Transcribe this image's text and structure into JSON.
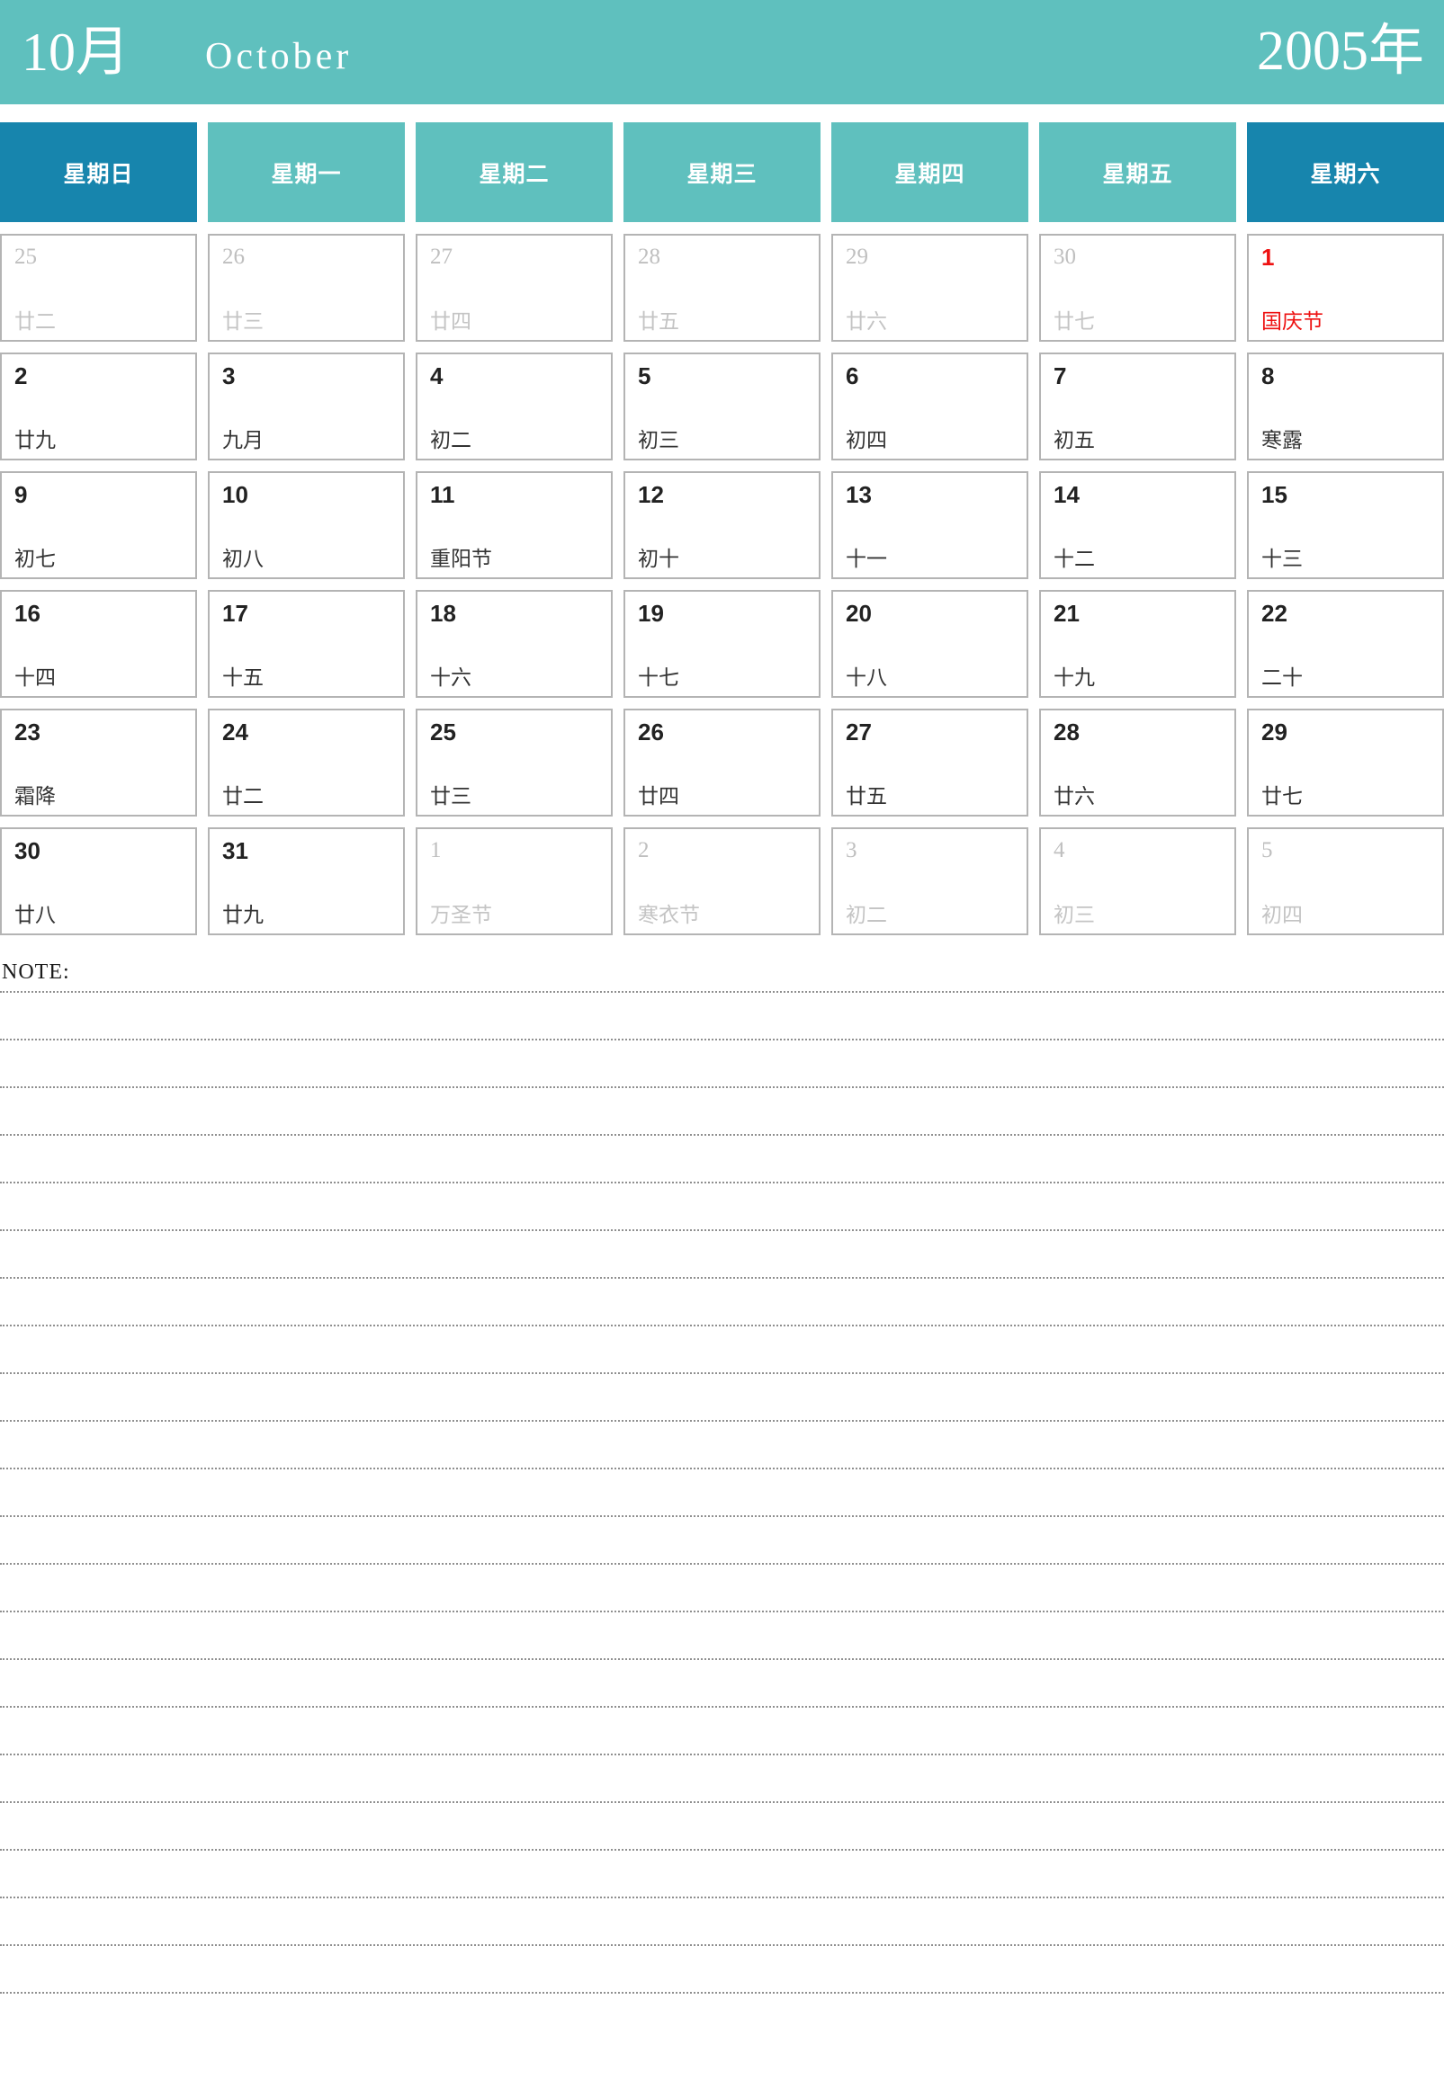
{
  "header": {
    "month_cn": "10月",
    "month_en": "October",
    "year_cn": "2005年",
    "bg_color": "#5FC0BE",
    "text_color": "#ffffff"
  },
  "weekdays": [
    {
      "label": "星期日",
      "type": "weekend",
      "color": "#1785AD"
    },
    {
      "label": "星期一",
      "type": "weekday",
      "color": "#5FC0BE"
    },
    {
      "label": "星期二",
      "type": "weekday",
      "color": "#5FC0BE"
    },
    {
      "label": "星期三",
      "type": "weekday",
      "color": "#5FC0BE"
    },
    {
      "label": "星期四",
      "type": "weekday",
      "color": "#5FC0BE"
    },
    {
      "label": "星期五",
      "type": "weekday",
      "color": "#5FC0BE"
    },
    {
      "label": "星期六",
      "type": "weekend",
      "color": "#1785AD"
    }
  ],
  "accent_colors": {
    "teal": "#5FC0BE",
    "deep_blue": "#1785AD",
    "holiday_red": "#ee1111",
    "muted_gray": "#bfbfbf",
    "cell_border": "#b4b4b4"
  },
  "weeks": [
    [
      {
        "day": "25",
        "lunar": "廿二",
        "state": "muted"
      },
      {
        "day": "26",
        "lunar": "廿三",
        "state": "muted"
      },
      {
        "day": "27",
        "lunar": "廿四",
        "state": "muted"
      },
      {
        "day": "28",
        "lunar": "廿五",
        "state": "muted"
      },
      {
        "day": "29",
        "lunar": "廿六",
        "state": "muted"
      },
      {
        "day": "30",
        "lunar": "廿七",
        "state": "muted"
      },
      {
        "day": "1",
        "lunar": "国庆节",
        "state": "holiday"
      }
    ],
    [
      {
        "day": "2",
        "lunar": "廿九",
        "state": "normal"
      },
      {
        "day": "3",
        "lunar": "九月",
        "state": "normal"
      },
      {
        "day": "4",
        "lunar": "初二",
        "state": "normal"
      },
      {
        "day": "5",
        "lunar": "初三",
        "state": "normal"
      },
      {
        "day": "6",
        "lunar": "初四",
        "state": "normal"
      },
      {
        "day": "7",
        "lunar": "初五",
        "state": "normal"
      },
      {
        "day": "8",
        "lunar": "寒露",
        "state": "normal"
      }
    ],
    [
      {
        "day": "9",
        "lunar": "初七",
        "state": "normal"
      },
      {
        "day": "10",
        "lunar": "初八",
        "state": "normal"
      },
      {
        "day": "11",
        "lunar": "重阳节",
        "state": "normal"
      },
      {
        "day": "12",
        "lunar": "初十",
        "state": "normal"
      },
      {
        "day": "13",
        "lunar": "十一",
        "state": "normal"
      },
      {
        "day": "14",
        "lunar": "十二",
        "state": "normal"
      },
      {
        "day": "15",
        "lunar": "十三",
        "state": "normal"
      }
    ],
    [
      {
        "day": "16",
        "lunar": "十四",
        "state": "normal"
      },
      {
        "day": "17",
        "lunar": "十五",
        "state": "normal"
      },
      {
        "day": "18",
        "lunar": "十六",
        "state": "normal"
      },
      {
        "day": "19",
        "lunar": "十七",
        "state": "normal"
      },
      {
        "day": "20",
        "lunar": "十八",
        "state": "normal"
      },
      {
        "day": "21",
        "lunar": "十九",
        "state": "normal"
      },
      {
        "day": "22",
        "lunar": "二十",
        "state": "normal"
      }
    ],
    [
      {
        "day": "23",
        "lunar": "霜降",
        "state": "normal"
      },
      {
        "day": "24",
        "lunar": "廿二",
        "state": "normal"
      },
      {
        "day": "25",
        "lunar": "廿三",
        "state": "normal"
      },
      {
        "day": "26",
        "lunar": "廿四",
        "state": "normal"
      },
      {
        "day": "27",
        "lunar": "廿五",
        "state": "normal"
      },
      {
        "day": "28",
        "lunar": "廿六",
        "state": "normal"
      },
      {
        "day": "29",
        "lunar": "廿七",
        "state": "normal"
      }
    ],
    [
      {
        "day": "30",
        "lunar": "廿八",
        "state": "normal"
      },
      {
        "day": "31",
        "lunar": "廿九",
        "state": "normal"
      },
      {
        "day": "1",
        "lunar": "万圣节",
        "state": "muted"
      },
      {
        "day": "2",
        "lunar": "寒衣节",
        "state": "muted"
      },
      {
        "day": "3",
        "lunar": "初二",
        "state": "muted"
      },
      {
        "day": "4",
        "lunar": "初三",
        "state": "muted"
      },
      {
        "day": "5",
        "lunar": "初四",
        "state": "muted"
      }
    ]
  ],
  "note": {
    "label": "NOTE:",
    "line_count": 22
  }
}
